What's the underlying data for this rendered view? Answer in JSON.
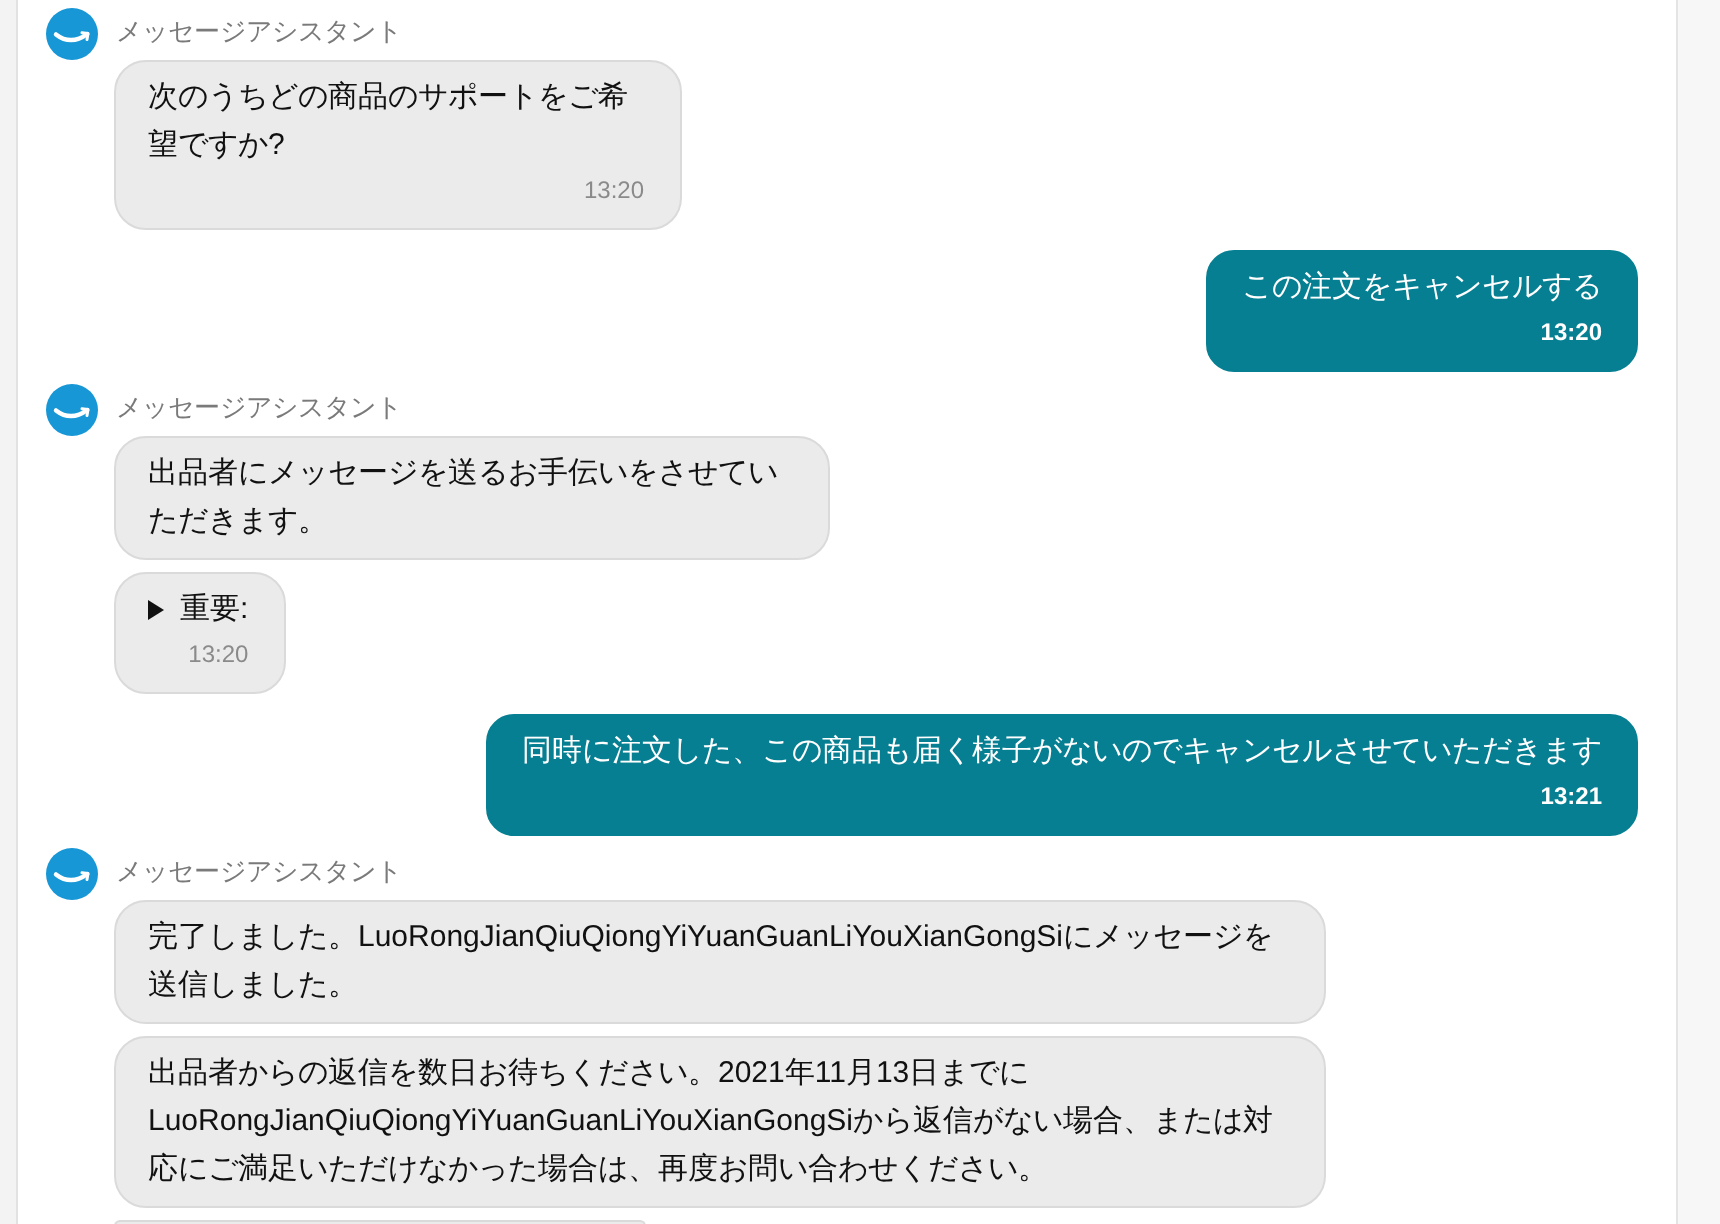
{
  "messages": [
    {
      "kind": "assistant",
      "sender": "メッセージアシスタント",
      "bubbles": [
        {
          "kind": "text",
          "text": "次のうちどの商品のサポートをご希望ですか?",
          "time": "13:20"
        }
      ]
    },
    {
      "kind": "user",
      "bubbles": [
        {
          "kind": "text",
          "text": "この注文をキャンセルする",
          "time": "13:20"
        }
      ]
    },
    {
      "kind": "assistant",
      "sender": "メッセージアシスタント",
      "bubbles": [
        {
          "kind": "text",
          "text": "出品者にメッセージを送るお手伝いをさせていただきます。"
        },
        {
          "kind": "disclosure",
          "label": "重要:",
          "expanded": false,
          "time": "13:20"
        }
      ]
    },
    {
      "kind": "user",
      "bubbles": [
        {
          "kind": "text",
          "text": "同時に注文した、この商品も届く様子がないのでキャンセルさせていただきます",
          "time": "13:21"
        }
      ]
    },
    {
      "kind": "assistant",
      "sender": "メッセージアシスタント",
      "bubbles": [
        {
          "kind": "text",
          "text": "完了しました。LuoRongJianQiuQiongYiYuanGuanLiYouXianGongSiにメッセージを送信しました。"
        },
        {
          "kind": "text",
          "text": "出品者からの返信を数日お待ちください。2021年11月13日までにLuoRongJianQiuQiongYiYuanGuanLiYouXianGongSiから返信がない場合、または対応にご満足いただけなかった場合は、再度お問い合わせください。"
        },
        {
          "kind": "cut_off"
        }
      ]
    }
  ]
}
